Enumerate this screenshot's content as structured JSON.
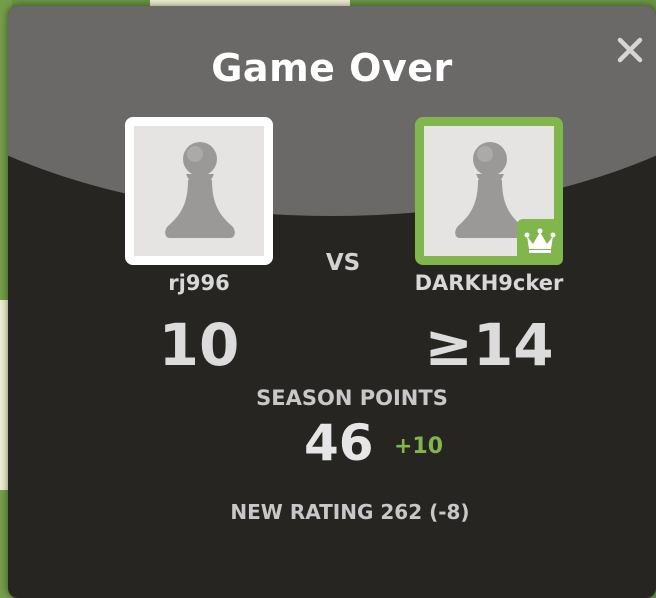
{
  "modal": {
    "title": "Game Over",
    "close_icon": "close-icon"
  },
  "players": {
    "left": {
      "name": "rj996",
      "score": "10",
      "avatar_icon": "pawn-icon",
      "border_color": "#ffffff"
    },
    "right": {
      "name": "DARKH9cker",
      "score": "≥14",
      "avatar_icon": "pawn-icon",
      "badge_icon": "crown-icon",
      "border_color": "#81b64c"
    }
  },
  "vs_label": "VS",
  "season": {
    "label": "SEASON POINTS",
    "value": "46",
    "delta": "+10"
  },
  "rating": {
    "text": "NEW RATING 262 (-8)"
  },
  "colors": {
    "accent_green": "#81b64c",
    "modal_bg": "#262522",
    "header_bg": "#6a6967"
  }
}
